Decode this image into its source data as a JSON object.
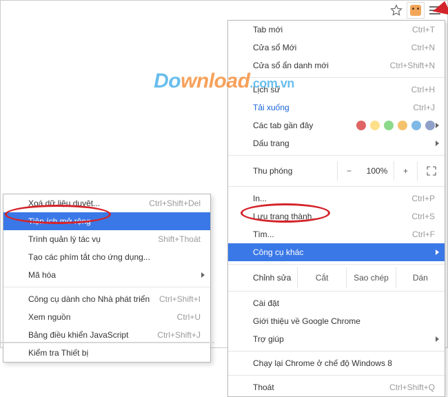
{
  "toolbar": {
    "star_icon": "star-icon",
    "extension_icon": "extension-icon",
    "menu_icon": "hamburger-icon"
  },
  "watermark": {
    "p1": "Do",
    "p2": "wnload",
    "p3": ".com.vn"
  },
  "menu": {
    "new_tab": {
      "label": "Tab mới",
      "shortcut": "Ctrl+T"
    },
    "new_window": {
      "label": "Cửa sổ Mới",
      "shortcut": "Ctrl+N"
    },
    "incognito": {
      "label": "Cửa sổ ẩn danh mới",
      "shortcut": "Ctrl+Shift+N"
    },
    "history": {
      "label": "Lịch sử",
      "shortcut": "Ctrl+H"
    },
    "downloads": {
      "label": "Tải xuống",
      "shortcut": "Ctrl+J"
    },
    "recent_tabs": {
      "label": "Các tab gần đây"
    },
    "bookmarks": {
      "label": "Dấu trang"
    },
    "zoom": {
      "label": "Thu phóng",
      "minus": "−",
      "value": "100%",
      "plus": "+"
    },
    "print": {
      "label": "In...",
      "shortcut": "Ctrl+P"
    },
    "save_as": {
      "label": "Lưu trang thành...",
      "shortcut": "Ctrl+S"
    },
    "find": {
      "label": "Tìm...",
      "shortcut": "Ctrl+F"
    },
    "more_tools": {
      "label": "Công cụ khác"
    },
    "edit": {
      "label": "Chỉnh sửa",
      "cut": "Cắt",
      "copy": "Sao chép",
      "paste": "Dán"
    },
    "settings": {
      "label": "Cài đặt"
    },
    "about": {
      "label": "Giới thiệu về Google Chrome"
    },
    "help": {
      "label": "Trợ giúp"
    },
    "relaunch_win8": {
      "label": "Chạy lại Chrome ở chế độ Windows 8"
    },
    "exit": {
      "label": "Thoát",
      "shortcut": "Ctrl+Shift+Q"
    },
    "dots": [
      "#e06464",
      "#ffe08a",
      "#8bd98b",
      "#f4c26b",
      "#7fb9e6",
      "#8fa0c9"
    ]
  },
  "submenu": {
    "clear_data": {
      "label": "Xoá dữ liệu duyệt...",
      "shortcut": "Ctrl+Shift+Del"
    },
    "extensions": {
      "label": "Tiện ích mở rộng"
    },
    "task_manager": {
      "label": "Trình quản lý tác vụ",
      "shortcut": "Shift+Thoát"
    },
    "create_shortcuts": {
      "label": "Tạo các phím tắt cho ứng dụng..."
    },
    "encoding": {
      "label": "Mã hóa"
    },
    "dev_tools": {
      "label": "Công cụ dành cho Nhà phát triển",
      "shortcut": "Ctrl+Shift+I"
    },
    "view_source": {
      "label": "Xem nguồn",
      "shortcut": "Ctrl+U"
    },
    "js_console": {
      "label": "Bảng điều khiển JavaScript",
      "shortcut": "Ctrl+Shift+J"
    },
    "inspect_devices": {
      "label": "Kiểm tra Thiết bị"
    }
  }
}
